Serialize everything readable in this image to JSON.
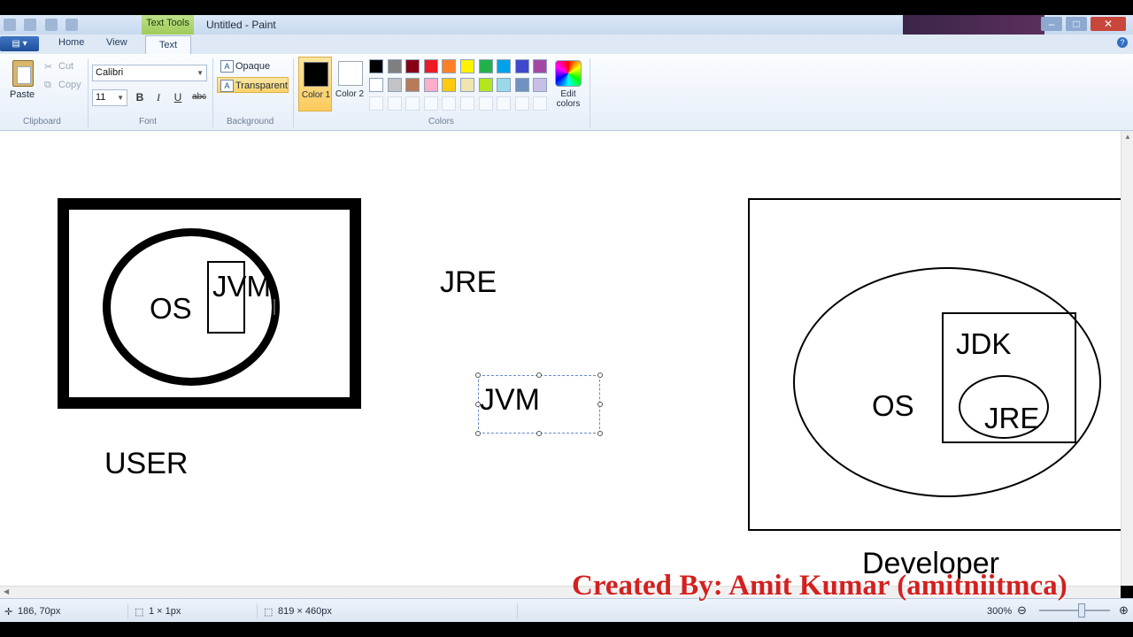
{
  "titlebar": {
    "context_tab": "Text Tools",
    "title": "Untitled - Paint"
  },
  "ribbon_tabs": [
    "Home",
    "View",
    "Text"
  ],
  "clipboard": {
    "paste": "Paste",
    "cut": "Cut",
    "copy": "Copy",
    "group": "Clipboard"
  },
  "font": {
    "family": "Calibri",
    "size": "11",
    "bold": "B",
    "italic": "I",
    "underline": "U",
    "strike": "abc",
    "group": "Font"
  },
  "background": {
    "opaque": "Opaque",
    "transparent": "Transparent",
    "group": "Background"
  },
  "colors": {
    "color1": "Color 1",
    "color2": "Color 2",
    "color1_value": "#000000",
    "color2_value": "#ffffff",
    "palette_row1": [
      "#000000",
      "#7f7f7f",
      "#880015",
      "#ed1c24",
      "#ff7f27",
      "#fff200",
      "#22b14c",
      "#00a2e8",
      "#3f48cc",
      "#a349a4"
    ],
    "palette_row2": [
      "#ffffff",
      "#c3c3c3",
      "#b97a57",
      "#ffaec9",
      "#ffc90e",
      "#efe4b0",
      "#b5e61d",
      "#99d9ea",
      "#7092be",
      "#c8bfe7"
    ],
    "edit": "Edit colors",
    "group": "Colors"
  },
  "canvas": {
    "user_box": {
      "os": "OS",
      "jvm": "JVM",
      "caption": "USER"
    },
    "jre_label": "JRE",
    "jvm_textbox": "JVM",
    "developer_box": {
      "os": "OS",
      "jdk": "JDK",
      "jre": "JRE",
      "caption": "Developer"
    }
  },
  "watermark": "Created By: Amit Kumar (amitniitmca)",
  "status": {
    "cursor": "186, 70px",
    "selection": "1 × 1px",
    "canvas_size": "819 × 460px",
    "zoom": "300%"
  }
}
